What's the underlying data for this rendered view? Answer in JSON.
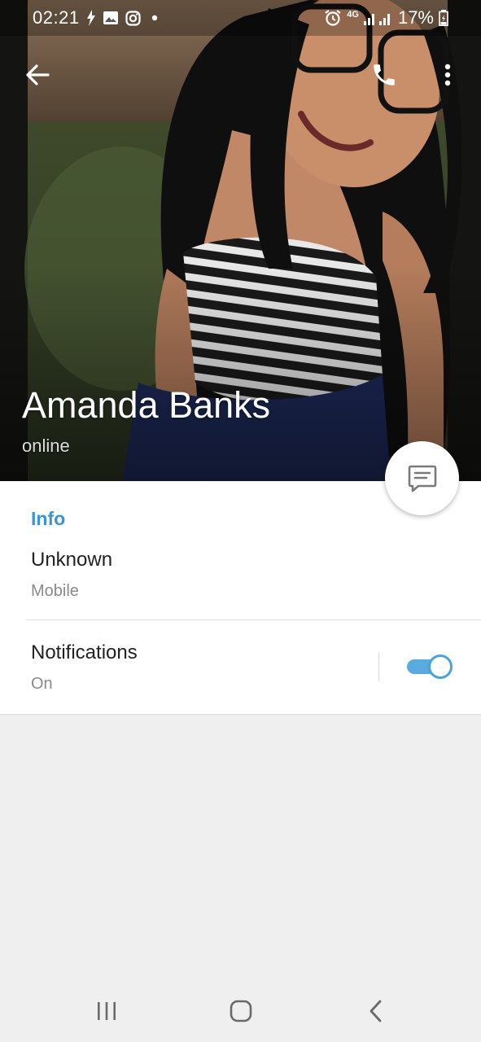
{
  "status_bar": {
    "time": "02:21",
    "network": "4G",
    "battery": "17%",
    "left_icons": [
      "flash-icon",
      "gallery-icon",
      "instagram-icon",
      "dot-icon"
    ],
    "right_icons": [
      "alarm-icon",
      "signal-icon",
      "battery-icon"
    ]
  },
  "toolbar": {
    "back_icon": "arrow-left-icon",
    "call_icon": "phone-icon",
    "more_icon": "more-vertical-icon"
  },
  "profile": {
    "name": "Amanda Banks",
    "status": "online"
  },
  "fab": {
    "icon": "message-icon"
  },
  "info": {
    "section_title": "Info",
    "phone_value": "Unknown",
    "phone_label": "Mobile",
    "notifications_title": "Notifications",
    "notifications_value": "On",
    "notifications_enabled": true
  },
  "colors": {
    "accent": "#3a95d0",
    "toggle_track": "#5aaae0",
    "background": "#efefef"
  },
  "nav_bar": {
    "recent_icon": "recent-apps-icon",
    "home_icon": "home-icon",
    "back_icon": "back-chevron-icon"
  }
}
